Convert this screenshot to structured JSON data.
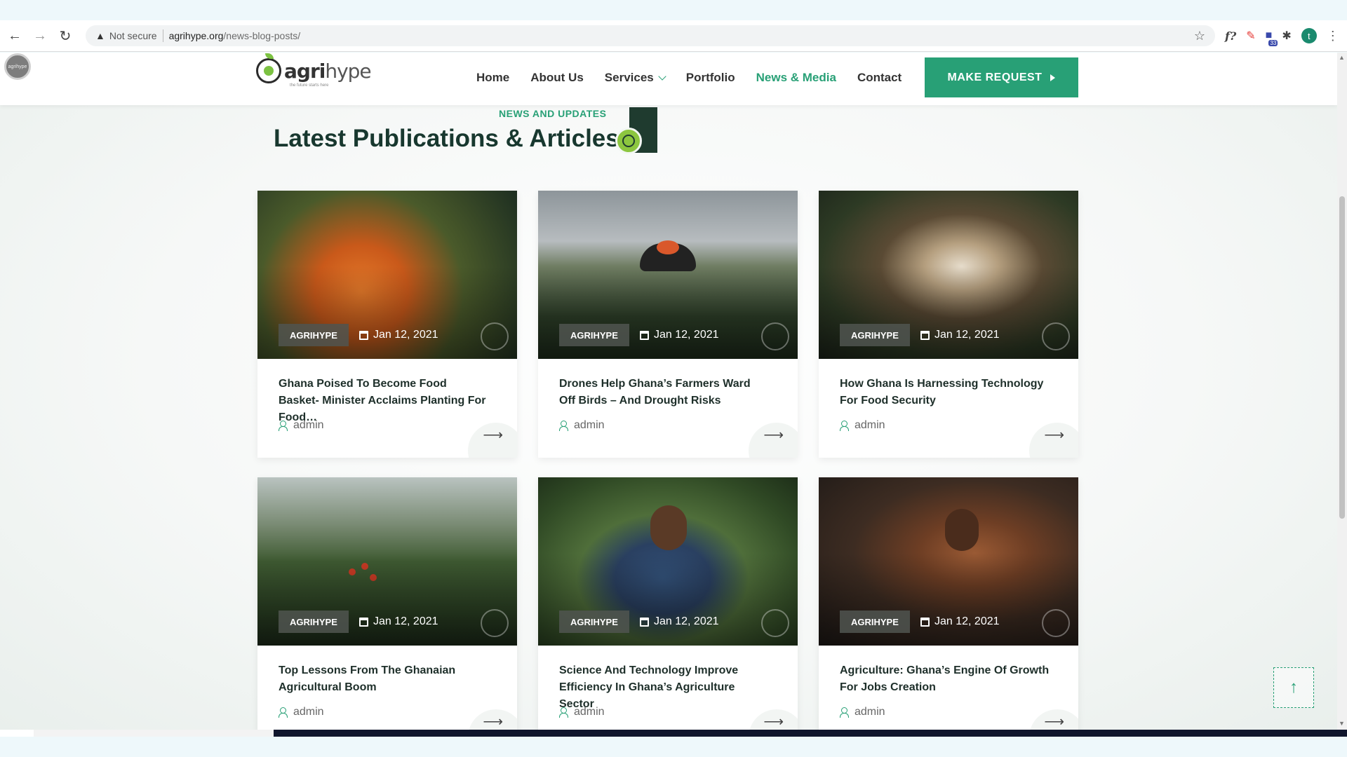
{
  "browser": {
    "not_secure_label": "Not secure",
    "url_host": "agrihype.org",
    "url_path": "/news-blog-posts/",
    "extensions": {
      "formula": "f?",
      "badge_count": "33",
      "profile_initial": "t"
    }
  },
  "site": {
    "logo_bold": "agri",
    "logo_light": "hype",
    "logo_tagline": "the future starts here",
    "floating_avatar_text": "agrihype",
    "nav": {
      "home": "Home",
      "about": "About Us",
      "services": "Services",
      "portfolio": "Portfolio",
      "news": "News & Media",
      "contact": "Contact"
    },
    "cta": "MAKE REQUEST"
  },
  "section": {
    "subtitle": "NEWS AND UPDATES",
    "title": "Latest Publications & Articles"
  },
  "posts": [
    {
      "tag": "AGRIHYPE",
      "date": "Jan 12, 2021",
      "title": "Ghana Poised To Become Food Basket- Minister Acclaims Planting For Food…",
      "author": "admin"
    },
    {
      "tag": "AGRIHYPE",
      "date": "Jan 12, 2021",
      "title": "Drones Help Ghana’s Farmers Ward Off Birds – And Drought Risks",
      "author": "admin"
    },
    {
      "tag": "AGRIHYPE",
      "date": "Jan 12, 2021",
      "title": "How Ghana Is Harnessing Technology For Food Security",
      "author": "admin"
    },
    {
      "tag": "AGRIHYPE",
      "date": "Jan 12, 2021",
      "title": "Top Lessons From The Ghanaian Agricultural Boom",
      "author": "admin"
    },
    {
      "tag": "AGRIHYPE",
      "date": "Jan 12, 2021",
      "title": "Science And Technology Improve Efficiency In Ghana’s Agriculture Sector",
      "author": "admin"
    },
    {
      "tag": "AGRIHYPE",
      "date": "Jan 12, 2021",
      "title": "Agriculture: Ghana’s Engine Of Growth For Jobs Creation",
      "author": "admin"
    }
  ],
  "colors": {
    "accent": "#28a076",
    "heading": "#18382f",
    "header_bg": "#ffffff"
  },
  "icons": {
    "back": "arrow-left-icon",
    "forward": "arrow-right-icon",
    "reload": "reload-icon",
    "warning": "warning-icon",
    "bookmark": "star-icon",
    "extensions": "puzzle-icon",
    "menu": "kebab-menu-icon",
    "calendar": "calendar-icon",
    "user": "user-icon",
    "read_more": "arrow-right-icon",
    "to_top": "arrow-up-icon"
  }
}
